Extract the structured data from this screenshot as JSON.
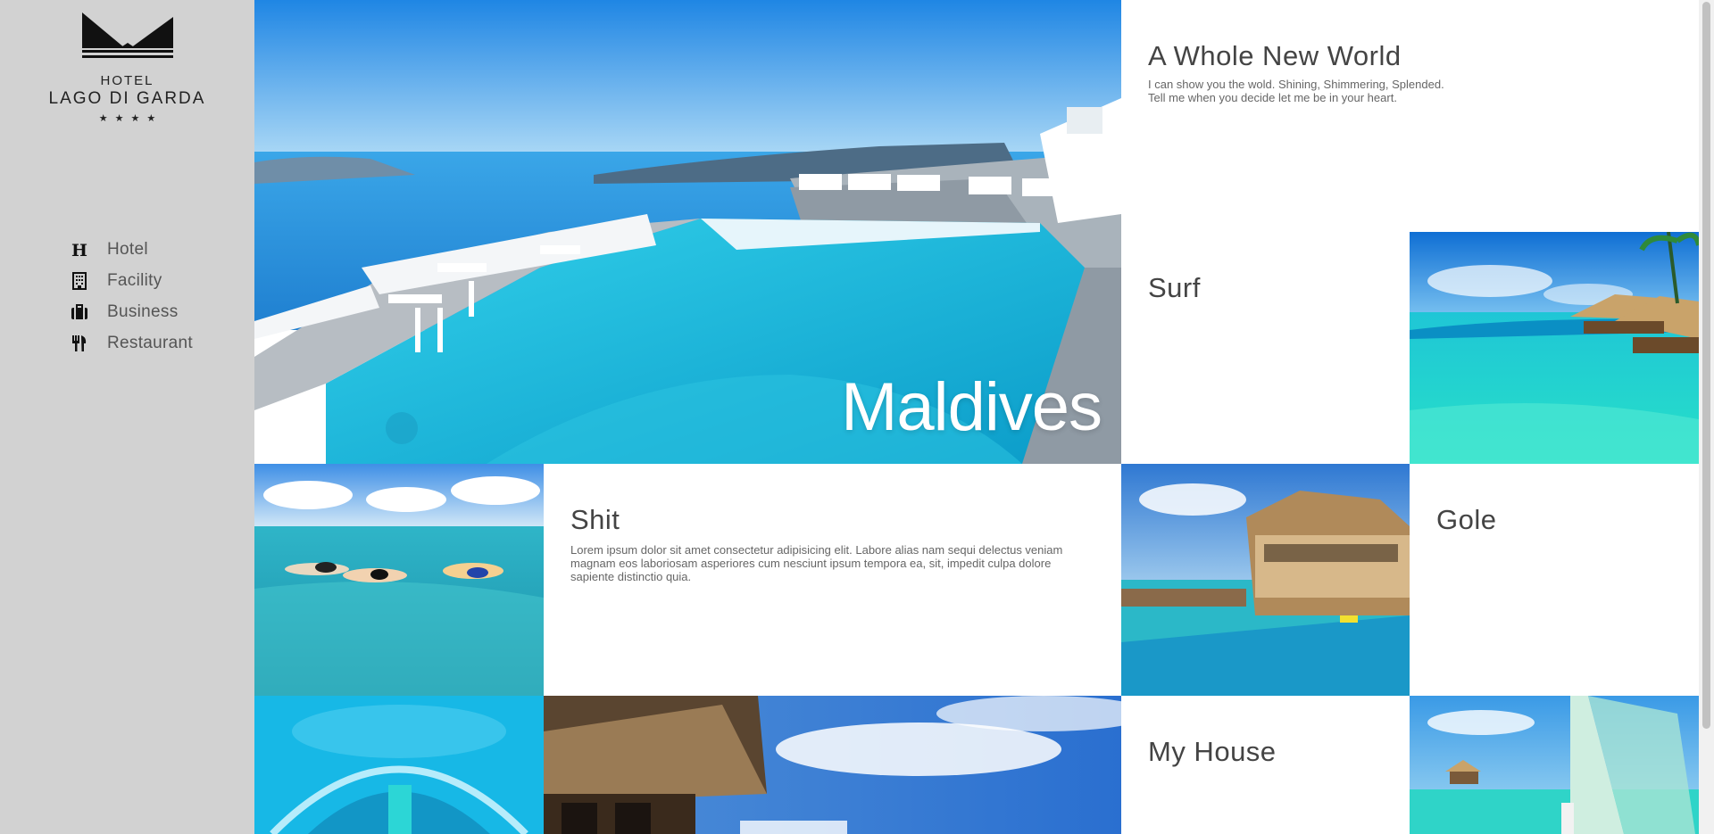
{
  "brand": {
    "line1": "HOTEL",
    "line2": "LAGO DI GARDA",
    "stars": "★★★★"
  },
  "nav": {
    "items": [
      {
        "label": "Hotel",
        "icon": "hotel-h-icon"
      },
      {
        "label": "Facility",
        "icon": "building-icon"
      },
      {
        "label": "Business",
        "icon": "briefcase-icon"
      },
      {
        "label": "Restaurant",
        "icon": "cutlery-icon"
      }
    ]
  },
  "hero": {
    "caption": "Maldives"
  },
  "tiles": {
    "whole_new_world": {
      "title": "A Whole New World",
      "desc_line1": "I can show you the wold. Shining, Shimmering, Splended.",
      "desc_line2": "Tell me when you decide let me be in your heart."
    },
    "surf": {
      "title": "Surf"
    },
    "shit": {
      "title": "Shit",
      "desc": "Lorem ipsum dolor sit amet consectetur adipisicing elit. Labore alias nam sequi delectus veniam magnam eos laboriosam asperiores cum nesciunt ipsum tempora ea, sit, impedit culpa dolore sapiente distinctio quia."
    },
    "gole": {
      "title": "Gole"
    },
    "my_house": {
      "title": "My House"
    }
  },
  "colors": {
    "sidebar_bg": "#d2d2d2",
    "text_dark": "#444444",
    "water": "#1ec2dc",
    "sky": "#2f8fe0"
  }
}
